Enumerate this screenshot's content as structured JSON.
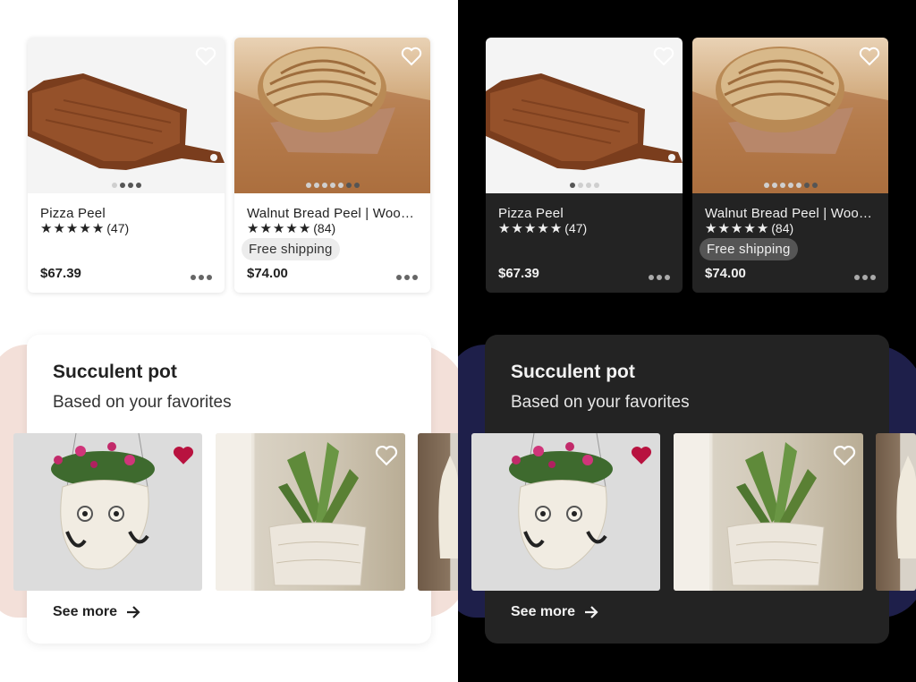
{
  "themes": [
    "light",
    "dark"
  ],
  "products": [
    {
      "title": "Pizza Peel",
      "rating_count": "(47)",
      "price": "$67.39",
      "free_shipping": null,
      "image_count": 4,
      "active_image": {
        "light": 1,
        "dark": 0
      }
    },
    {
      "title": "Walnut Bread Peel | Woo…",
      "rating_count": "(84)",
      "price": "$74.00",
      "free_shipping": "Free shipping",
      "image_count": 7,
      "active_image": {
        "light": 5,
        "dark": 5
      }
    }
  ],
  "collection": {
    "title": "Succulent pot",
    "subtitle": "Based on your favorites",
    "see_more": "See more",
    "items": [
      {
        "name": "owl-planter",
        "favorited": true
      },
      {
        "name": "aloe-pot",
        "favorited": false
      },
      {
        "name": "cat-planter",
        "favorited": false
      }
    ]
  },
  "colors": {
    "favorite_red": "#b8123f",
    "light_backdrop": "#f3e0d9",
    "dark_backdrop": "#1e1f4a"
  },
  "icons": [
    "heart-icon",
    "heart-filled-icon",
    "star-icon",
    "more-icon",
    "arrow-right-icon"
  ]
}
